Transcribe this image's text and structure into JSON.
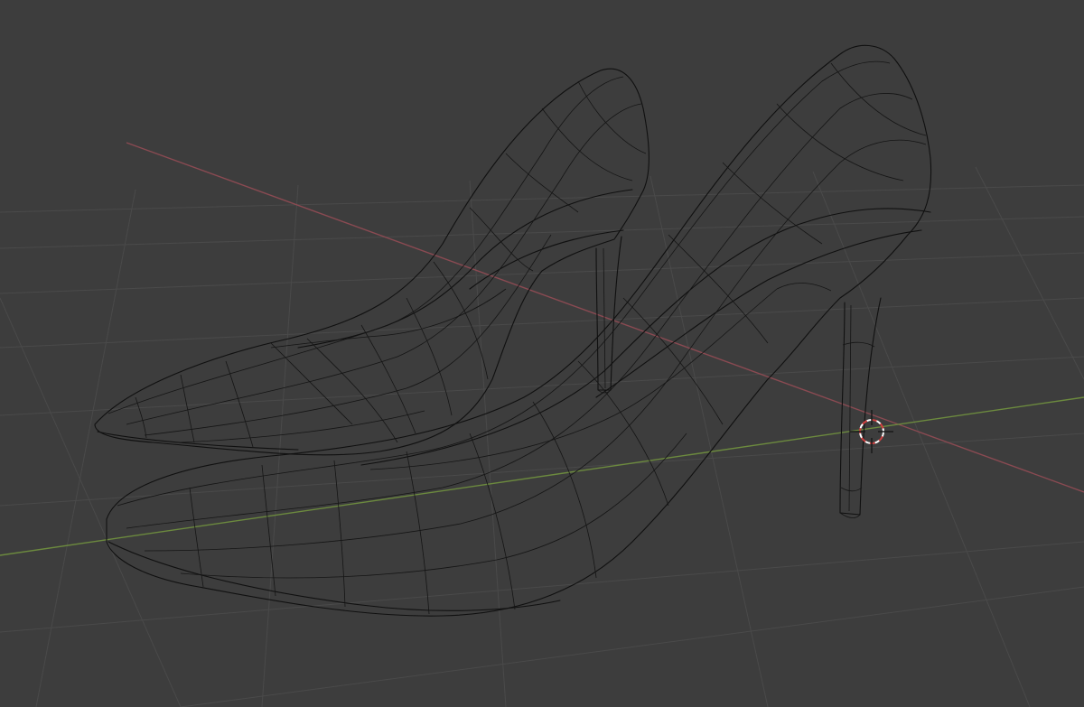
{
  "viewport": {
    "background": "#3d3d3d",
    "grid_color": "#4a4a4a",
    "x_axis_color": "#8a4a52",
    "y_axis_color": "#6c8a3e",
    "wire_color": "#101010",
    "mode": "wireframe"
  },
  "objects": [
    {
      "name": "left-pump-shoe"
    },
    {
      "name": "right-pump-shoe"
    }
  ],
  "cursor": {
    "icon": "3d-cursor-icon",
    "colors": [
      "#ffffff",
      "#d04040"
    ]
  }
}
